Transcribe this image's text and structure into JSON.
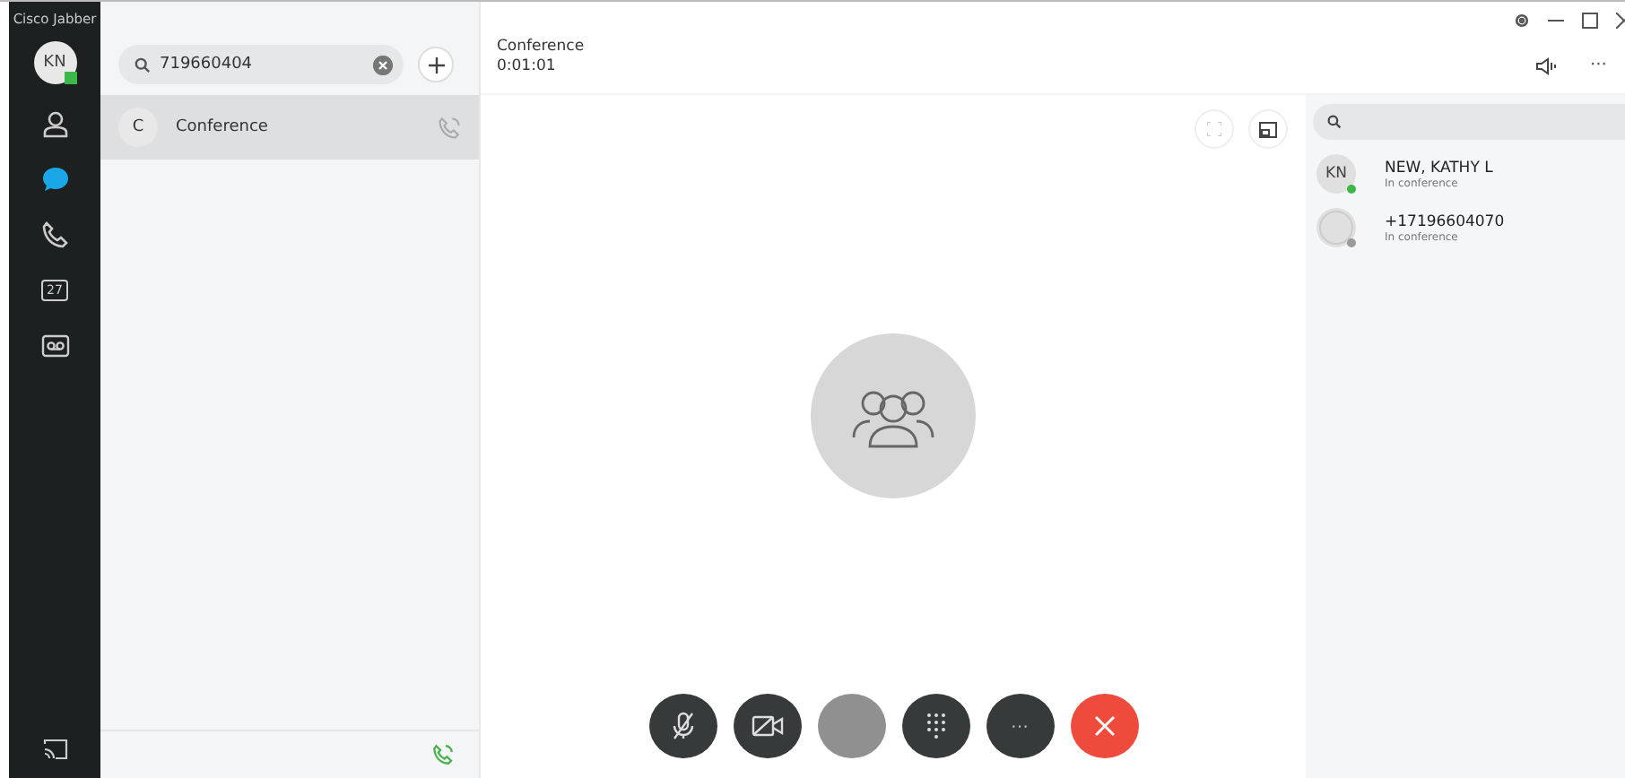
{
  "app": {
    "title": "Cisco Jabber",
    "user_initials": "KN"
  },
  "nav": [
    {
      "kind": "contacts",
      "selected": false
    },
    {
      "kind": "chats",
      "selected": true
    },
    {
      "kind": "calls",
      "selected": false
    },
    {
      "kind": "meetings",
      "label": "27",
      "selected": false
    },
    {
      "kind": "voicemail",
      "selected": false
    }
  ],
  "search": {
    "value": "719660404"
  },
  "conversations": [
    {
      "initial": "C",
      "name": "Conference",
      "selected": true
    }
  ],
  "call": {
    "title": "Conference",
    "duration": "0:01:01",
    "more": "···"
  },
  "controls": [
    {
      "kind": "mute",
      "disabled": false
    },
    {
      "kind": "video",
      "disabled": false
    },
    {
      "kind": "share",
      "disabled": true
    },
    {
      "kind": "keypad",
      "disabled": false
    },
    {
      "kind": "more",
      "label": "···",
      "disabled": false
    },
    {
      "kind": "end",
      "disabled": false
    }
  ],
  "participants": [
    {
      "initials": "KN",
      "name": "NEW, KATHY L",
      "status": "In conference",
      "color": "#3cb84a"
    },
    {
      "name": "+17196604070",
      "status": "In conference",
      "color": "#9a9a9a"
    }
  ]
}
